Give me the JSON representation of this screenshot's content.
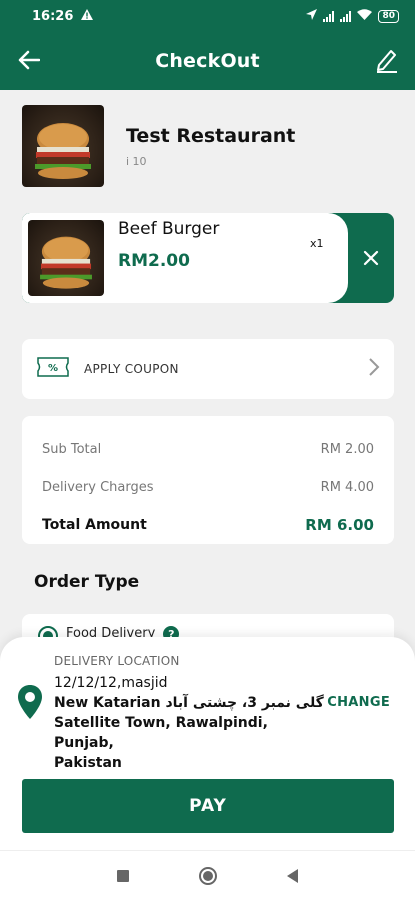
{
  "status_bar": {
    "time": "16:26",
    "battery": "80"
  },
  "app_bar": {
    "title": "CheckOut"
  },
  "restaurant": {
    "name": "Test Restaurant",
    "subtitle": "i 10"
  },
  "cart_item": {
    "name": "Beef Burger",
    "price": "RM2.00",
    "quantity": "x1"
  },
  "coupon": {
    "label": "APPLY COUPON"
  },
  "summary": {
    "subtotal_label": "Sub Total",
    "subtotal_value": "RM 2.00",
    "delivery_label": "Delivery Charges",
    "delivery_value": "RM 4.00",
    "total_label": "Total Amount",
    "total_value": "RM 6.00"
  },
  "order_type": {
    "title": "Order Type",
    "option": "Food Delivery",
    "help": "?"
  },
  "delivery": {
    "label": "DELIVERY LOCATION",
    "line1": "12/12/12,masjid",
    "line2": "New Katarian گلی نمبر 3، چشتی آباد",
    "line3": "Satellite Town, Rawalpindi, Punjab,",
    "line4": "Pakistan",
    "change_label": "CHANGE"
  },
  "pay": {
    "label": "PAY"
  },
  "colors": {
    "primary": "#0f6b4e",
    "background": "#f0f0f0"
  }
}
